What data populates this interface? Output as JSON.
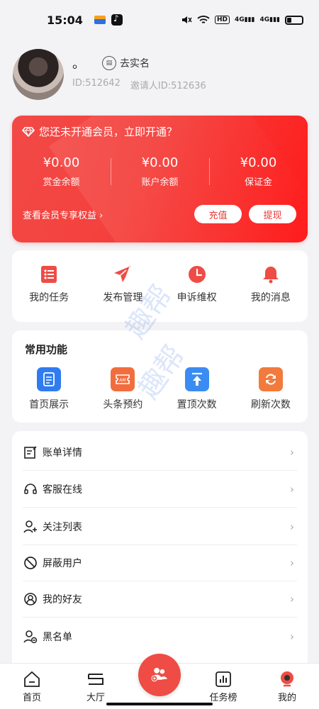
{
  "status_bar": {
    "time": "15:04",
    "network": "4G",
    "hd": "HD"
  },
  "profile": {
    "nickname": "。",
    "verify_label": "去实名",
    "id_text": "ID:512642",
    "inviter_text": "邀请人ID:512636"
  },
  "member_card": {
    "title": "您还未开通会员，立即开通？",
    "balances": [
      {
        "value": "¥0.00",
        "label": "赏金余额"
      },
      {
        "value": "¥0.00",
        "label": "账户余额"
      },
      {
        "value": "¥0.00",
        "label": "保证金"
      }
    ],
    "benefits_link": "查看会员专享权益 ›",
    "recharge_label": "充值",
    "withdraw_label": "提现",
    "accent": "#f4403c"
  },
  "quick_actions": [
    {
      "label": "我的任务",
      "icon": "task-list-icon"
    },
    {
      "label": "发布管理",
      "icon": "paper-plane-icon"
    },
    {
      "label": "申诉维权",
      "icon": "clock-icon"
    },
    {
      "label": "我的消息",
      "icon": "bell-icon"
    }
  ],
  "common": {
    "title": "常用功能",
    "items": [
      {
        "label": "首页展示",
        "icon": "document-icon",
        "color": "#2f7cf0"
      },
      {
        "label": "头条预约",
        "icon": "ticket-icon",
        "color": "#f26d3d"
      },
      {
        "label": "置顶次数",
        "icon": "pin-top-icon",
        "color": "#3b8cf2"
      },
      {
        "label": "刷新次数",
        "icon": "refresh-icon",
        "color": "#f27a3c"
      }
    ]
  },
  "menu": [
    {
      "label": "账单详情",
      "icon": "bill-icon"
    },
    {
      "label": "客服在线",
      "icon": "headset-icon"
    },
    {
      "label": "关注列表",
      "icon": "user-add-icon"
    },
    {
      "label": "屏蔽用户",
      "icon": "block-icon"
    },
    {
      "label": "我的好友",
      "icon": "friend-icon"
    },
    {
      "label": "黑名单",
      "icon": "user-remove-icon"
    }
  ],
  "watermark": "趣帮",
  "tabbar": [
    {
      "label": "首页",
      "icon": "home-icon"
    },
    {
      "label": "大厅",
      "icon": "hall-icon"
    },
    {
      "label": "",
      "icon": "group-add-icon"
    },
    {
      "label": "任务榜",
      "icon": "chart-icon"
    },
    {
      "label": "我的",
      "icon": "mine-icon"
    }
  ]
}
